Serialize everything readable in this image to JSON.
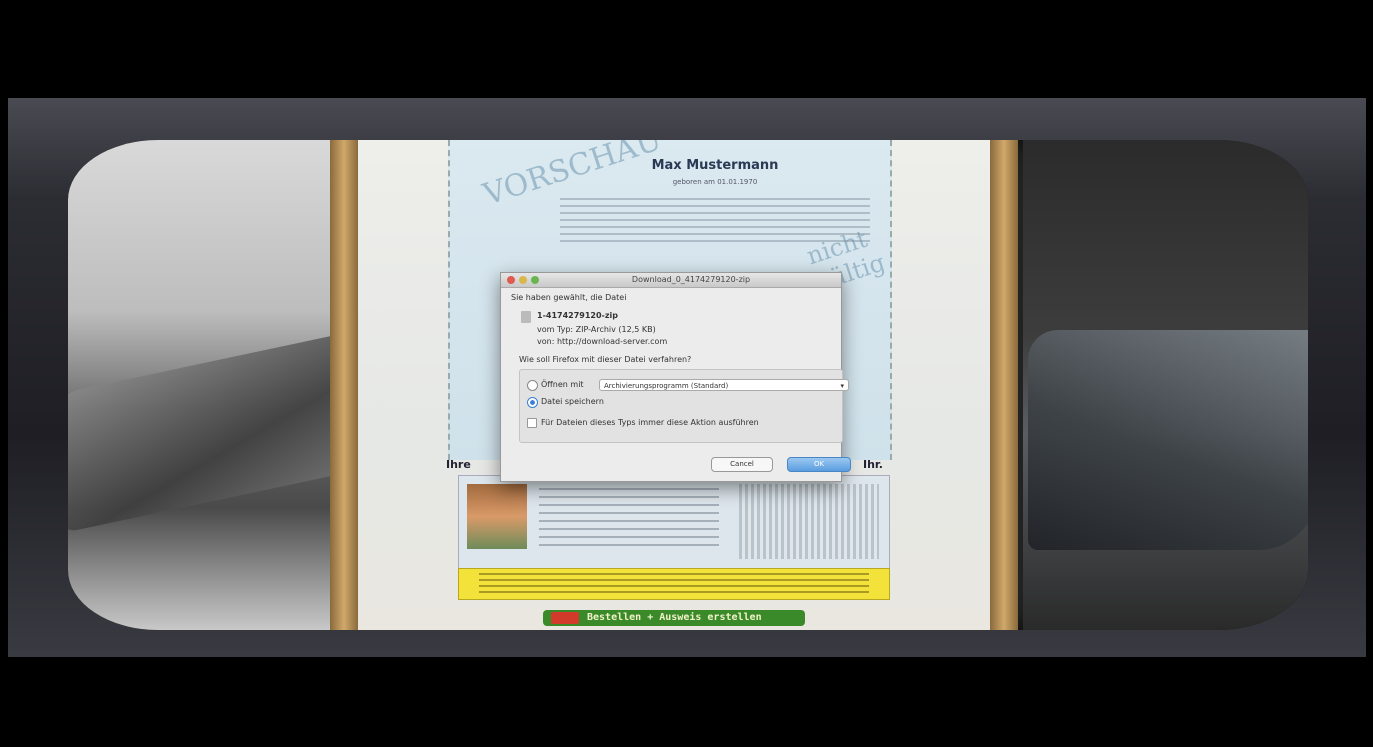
{
  "dialog": {
    "title": "Download_0_4174279120-zip",
    "heading": "Sie haben gewählt, die Datei",
    "file_name": "1-4174279120-zip",
    "file_type_line": "vom Typ: ZIP-Archiv (12,5 KB)",
    "source_line": "von: http://download-server.com",
    "question": "Wie soll Firefox mit dieser Datei verfahren?",
    "open_with_label": "Öffnen mit",
    "open_with_value": "Archivierungsprogramm (Standard)",
    "save_file_label": "Datei speichern",
    "remember_label": "Für Dateien dieses Typs immer diese Aktion ausführen",
    "cancel_label": "Cancel",
    "ok_label": "OK"
  },
  "document": {
    "name": "Max Mustermann",
    "sub_line": "geboren am 01.01.1970",
    "watermark": "VORSCHAU",
    "watermark_right": "nicht gültig",
    "id_label_left": "Ihre",
    "id_label_right": "Ihr.",
    "button_label": "Bestellen + Ausweis erstellen"
  },
  "colors": {
    "banner": "#f2e23a",
    "button": "#3a8a2a",
    "ok_accent": "#5a9de0"
  }
}
